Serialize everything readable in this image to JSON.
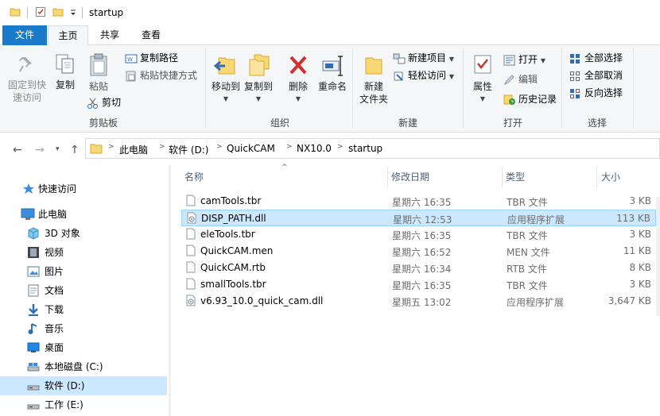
{
  "window": {
    "title": "startup"
  },
  "ribbon_tabs": [
    "文件",
    "主页",
    "共享",
    "查看"
  ],
  "ribbon": {
    "clipboard": {
      "pin_label": "固定到快\n速访问",
      "copy_label": "复制",
      "paste_label": "粘贴",
      "copy_path_label": "复制路径",
      "paste_shortcut_label": "粘贴快捷方式",
      "cut_label": "剪切",
      "group_label": "剪贴板"
    },
    "organize": {
      "move_to_label": "移动到",
      "copy_to_label": "复制到",
      "delete_label": "删除",
      "rename_label": "重命名",
      "group_label": "组织"
    },
    "new": {
      "new_folder_label": "新建\n文件夹",
      "new_item_label": "新建项目",
      "easy_access_label": "轻松访问",
      "group_label": "新建"
    },
    "open": {
      "properties_label": "属性",
      "open_label": "打开",
      "edit_label": "编辑",
      "history_label": "历史记录",
      "group_label": "打开"
    },
    "select": {
      "select_all_label": "全部选择",
      "select_none_label": "全部取消",
      "invert_label": "反向选择",
      "group_label": "选择"
    }
  },
  "address": {
    "crumbs": [
      "此电脑",
      "软件 (D:)",
      "QuickCAM",
      "NX10.0",
      "startup"
    ]
  },
  "nav": {
    "items": [
      {
        "label": "快速访问",
        "icon": "star-icon"
      },
      {
        "label": "此电脑",
        "icon": "pc-icon"
      },
      {
        "label": "3D 对象",
        "icon": "3d-objects-icon"
      },
      {
        "label": "视频",
        "icon": "video-icon"
      },
      {
        "label": "图片",
        "icon": "pictures-icon"
      },
      {
        "label": "文档",
        "icon": "documents-icon"
      },
      {
        "label": "下载",
        "icon": "download-icon"
      },
      {
        "label": "音乐",
        "icon": "music-icon"
      },
      {
        "label": "桌面",
        "icon": "desktop-icon"
      },
      {
        "label": "本地磁盘 (C:)",
        "icon": "drive-c-icon"
      },
      {
        "label": "软件 (D:)",
        "icon": "drive-d-icon"
      },
      {
        "label": "工作 (E:)",
        "icon": "drive-e-icon"
      }
    ],
    "selected_index": 10
  },
  "list": {
    "columns": [
      "名称",
      "修改日期",
      "类型",
      "大小"
    ],
    "rows": [
      {
        "name": "camTools.tbr",
        "date": "星期六 16:35",
        "type": "TBR 文件",
        "size": "3 KB",
        "icon": "file-icon"
      },
      {
        "name": "DISP_PATH.dll",
        "date": "星期六 12:53",
        "type": "应用程序扩展",
        "size": "113 KB",
        "icon": "dll-icon"
      },
      {
        "name": "eleTools.tbr",
        "date": "星期六 16:35",
        "type": "TBR 文件",
        "size": "3 KB",
        "icon": "file-icon"
      },
      {
        "name": "QuickCAM.men",
        "date": "星期六 16:52",
        "type": "MEN 文件",
        "size": "11 KB",
        "icon": "file-icon"
      },
      {
        "name": "QuickCAM.rtb",
        "date": "星期六 16:34",
        "type": "RTB 文件",
        "size": "8 KB",
        "icon": "file-icon"
      },
      {
        "name": "smallTools.tbr",
        "date": "星期六 16:35",
        "type": "TBR 文件",
        "size": "3 KB",
        "icon": "file-icon"
      },
      {
        "name": "v6.93_10.0_quick_cam.dll",
        "date": "星期五 13:02",
        "type": "应用程序扩展",
        "size": "3,647 KB",
        "icon": "dll-icon"
      }
    ],
    "selected_index": 1
  },
  "colors": {
    "file_tab": "#1979ca",
    "selection": "#cce8ff",
    "selection_border": "#99d1ff",
    "folder": "#f8d775"
  }
}
